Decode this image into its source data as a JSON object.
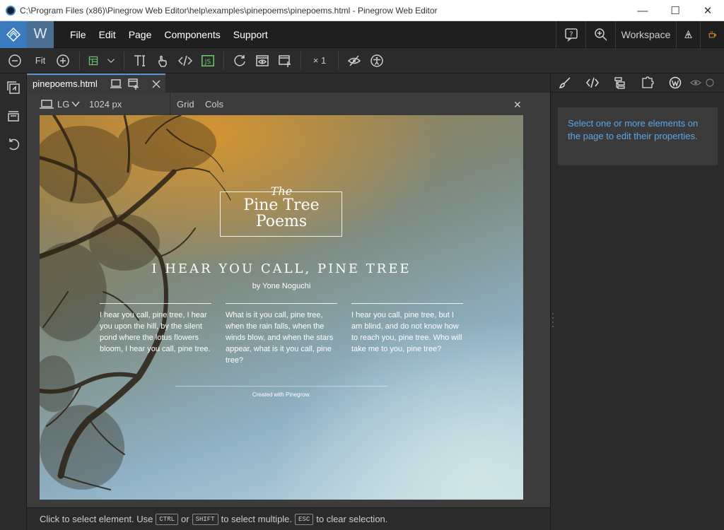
{
  "window": {
    "title": "C:\\Program Files (x86)\\Pinegrow Web Editor\\help\\examples\\pinepoems\\pinepoems.html - Pinegrow Web Editor"
  },
  "menubar": {
    "logo_w": "W",
    "items": [
      "File",
      "Edit",
      "Page",
      "Components",
      "Support"
    ],
    "workspace_label": "Workspace"
  },
  "toolbar": {
    "fit_label": "Fit",
    "multiplier_label": "× 1"
  },
  "tab": {
    "label": "pinepoems.html"
  },
  "viewport": {
    "size_label": "LG",
    "width_label": "1024 px",
    "grid_label": "Grid",
    "cols_label": "Cols"
  },
  "page": {
    "the": "The",
    "name_line1": "Pine Tree",
    "name_line2": "Poems",
    "heading": "I HEAR YOU CALL, PINE TREE",
    "byline": "by Yone Noguchi",
    "columns": [
      "I hear you call, pine tree, I hear you upon the hill, by the silent pond where the lotus flowers bloom, I hear you call, pine tree.",
      "What is it you call, pine tree, when the rain falls, when the winds blow, and when the stars appear, what is it you call, pine tree?",
      "I hear you call, pine tree, but I am blind, and do not know how to reach you, pine tree. Who will take me to you, pine tree?"
    ],
    "credit": "Created with Pinegrow."
  },
  "properties": {
    "info": "Select one or more elements on the page to edit their properties."
  },
  "status": {
    "part1": "Click to select element. Use",
    "key1": "CTRL",
    "part2": "or",
    "key2": "SHIFT",
    "part3": "to select multiple.",
    "key3": "ESC",
    "part4": "to clear selection."
  },
  "colors": {
    "accent": "#5aa9e6",
    "active_tab": "#5a9bd5",
    "coffee_icon": "#e8892f",
    "js_icon": "#6fcf6f"
  }
}
